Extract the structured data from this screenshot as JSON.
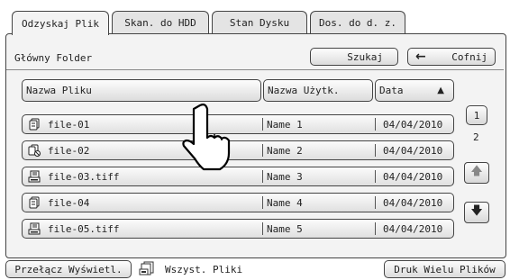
{
  "tabs": [
    {
      "label": "Odzyskaj Plik",
      "active": true
    },
    {
      "label": "Skan. do HDD",
      "active": false
    },
    {
      "label": "Stan Dysku",
      "active": false
    },
    {
      "label": "Dos. do d. z.",
      "active": false
    }
  ],
  "folder": {
    "label": "Główny Folder"
  },
  "toolbar": {
    "search_label": "Szukaj",
    "back_label": "Cofnij"
  },
  "columns": {
    "name": "Nazwa Pliku",
    "user": "Nazwa Użytk.",
    "date": "Data"
  },
  "files": [
    {
      "name": "file-01",
      "user": "Name 1",
      "date": "04/04/2010",
      "icon": "copy-icon"
    },
    {
      "name": "file-02",
      "user": "Name 2",
      "date": "04/04/2010",
      "icon": "copy-blocked-icon"
    },
    {
      "name": "file-03.tiff",
      "user": "Name 3",
      "date": "04/04/2010",
      "icon": "scan-icon"
    },
    {
      "name": "file-04",
      "user": "Name 4",
      "date": "04/04/2010",
      "icon": "copy-icon"
    },
    {
      "name": "file-05.tiff",
      "user": "Name 5",
      "date": "04/04/2010",
      "icon": "scan-icon"
    }
  ],
  "pager": {
    "current": "1",
    "total": "2"
  },
  "footer": {
    "toggle_label": "Przełącz Wyświetl.",
    "filter_label": "Wszyst. Pliki",
    "batch_print_label": "Druk Wielu Plików"
  }
}
